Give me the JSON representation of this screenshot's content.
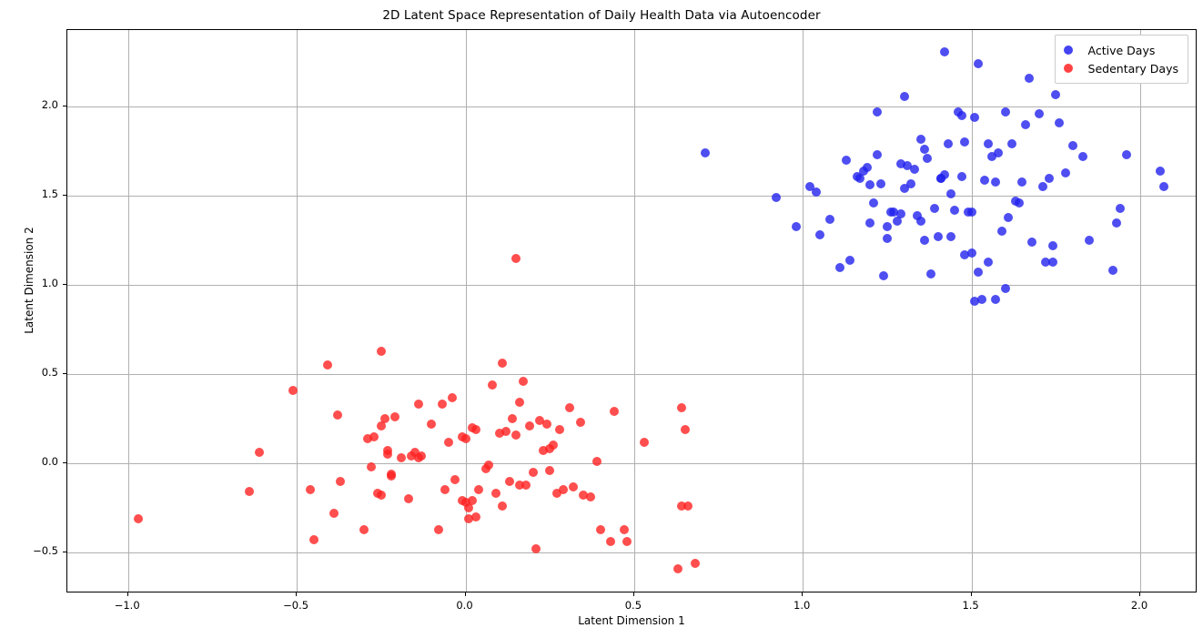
{
  "chart_data": {
    "type": "scatter",
    "title": "2D Latent Space Representation of Daily Health Data via Autoencoder",
    "xlabel": "Latent Dimension 1",
    "ylabel": "Latent Dimension 2",
    "xlim": [
      -1.18,
      2.17
    ],
    "ylim": [
      -0.73,
      2.43
    ],
    "xticks": [
      -1.0,
      -0.5,
      0.0,
      0.5,
      1.0,
      1.5,
      2.0
    ],
    "xticklabels": [
      "−1.0",
      "−0.5",
      "0.0",
      "0.5",
      "1.0",
      "1.5",
      "2.0"
    ],
    "yticks": [
      -0.5,
      0.0,
      0.5,
      1.0,
      1.5,
      2.0
    ],
    "yticklabels": [
      "−0.5",
      "0.0",
      "0.5",
      "1.0",
      "1.5",
      "2.0"
    ],
    "grid": true,
    "legend_position": "upper right",
    "marker_size": 10,
    "marker_alpha": 0.8,
    "series": [
      {
        "name": "Active Days",
        "color": "#2222ee",
        "points": [
          [
            0.71,
            1.74
          ],
          [
            0.92,
            1.49
          ],
          [
            0.98,
            1.33
          ],
          [
            1.02,
            1.55
          ],
          [
            1.04,
            1.52
          ],
          [
            1.05,
            1.28
          ],
          [
            1.08,
            1.37
          ],
          [
            1.11,
            1.1
          ],
          [
            1.13,
            1.7
          ],
          [
            1.14,
            1.14
          ],
          [
            1.16,
            1.61
          ],
          [
            1.17,
            1.6
          ],
          [
            1.18,
            1.64
          ],
          [
            1.19,
            1.66
          ],
          [
            1.2,
            1.35
          ],
          [
            1.2,
            1.56
          ],
          [
            1.21,
            1.46
          ],
          [
            1.22,
            1.97
          ],
          [
            1.22,
            1.73
          ],
          [
            1.23,
            1.57
          ],
          [
            1.24,
            1.05
          ],
          [
            1.25,
            1.26
          ],
          [
            1.25,
            1.33
          ],
          [
            1.26,
            1.41
          ],
          [
            1.27,
            1.41
          ],
          [
            1.28,
            1.36
          ],
          [
            1.29,
            1.68
          ],
          [
            1.29,
            1.4
          ],
          [
            1.3,
            2.06
          ],
          [
            1.3,
            1.54
          ],
          [
            1.31,
            1.67
          ],
          [
            1.32,
            1.57
          ],
          [
            1.33,
            1.65
          ],
          [
            1.34,
            1.39
          ],
          [
            1.35,
            1.82
          ],
          [
            1.35,
            1.36
          ],
          [
            1.36,
            1.76
          ],
          [
            1.36,
            1.25
          ],
          [
            1.37,
            1.71
          ],
          [
            1.38,
            1.06
          ],
          [
            1.39,
            1.43
          ],
          [
            1.4,
            1.27
          ],
          [
            1.41,
            1.6
          ],
          [
            1.41,
            1.6
          ],
          [
            1.42,
            2.31
          ],
          [
            1.42,
            1.62
          ],
          [
            1.43,
            1.79
          ],
          [
            1.44,
            1.51
          ],
          [
            1.44,
            1.27
          ],
          [
            1.45,
            1.42
          ],
          [
            1.46,
            1.97
          ],
          [
            1.47,
            1.95
          ],
          [
            1.47,
            1.61
          ],
          [
            1.48,
            1.8
          ],
          [
            1.48,
            1.17
          ],
          [
            1.49,
            1.41
          ],
          [
            1.5,
            1.18
          ],
          [
            1.5,
            1.41
          ],
          [
            1.51,
            0.91
          ],
          [
            1.51,
            1.94
          ],
          [
            1.52,
            1.07
          ],
          [
            1.52,
            2.24
          ],
          [
            1.53,
            0.92
          ],
          [
            1.54,
            1.59
          ],
          [
            1.55,
            1.79
          ],
          [
            1.55,
            1.13
          ],
          [
            1.56,
            1.72
          ],
          [
            1.57,
            1.58
          ],
          [
            1.57,
            0.92
          ],
          [
            1.58,
            1.74
          ],
          [
            1.59,
            1.3
          ],
          [
            1.6,
            1.97
          ],
          [
            1.6,
            0.98
          ],
          [
            1.61,
            1.38
          ],
          [
            1.62,
            1.79
          ],
          [
            1.63,
            1.47
          ],
          [
            1.64,
            1.46
          ],
          [
            1.65,
            1.58
          ],
          [
            1.66,
            1.9
          ],
          [
            1.67,
            2.16
          ],
          [
            1.68,
            1.24
          ],
          [
            1.7,
            1.96
          ],
          [
            1.71,
            1.55
          ],
          [
            1.72,
            1.13
          ],
          [
            1.73,
            1.6
          ],
          [
            1.74,
            1.13
          ],
          [
            1.74,
            1.22
          ],
          [
            1.75,
            2.07
          ],
          [
            1.76,
            1.91
          ],
          [
            1.78,
            1.63
          ],
          [
            1.8,
            1.78
          ],
          [
            1.83,
            1.72
          ],
          [
            1.85,
            1.25
          ],
          [
            1.92,
            1.08
          ],
          [
            1.94,
            1.43
          ],
          [
            1.96,
            1.73
          ],
          [
            1.93,
            1.35
          ],
          [
            2.06,
            1.64
          ],
          [
            2.07,
            1.55
          ]
        ]
      },
      {
        "name": "Sedentary Days",
        "color": "#ff2222",
        "points": [
          [
            -0.97,
            -0.31
          ],
          [
            -0.64,
            -0.16
          ],
          [
            -0.61,
            0.06
          ],
          [
            -0.51,
            0.41
          ],
          [
            -0.46,
            -0.15
          ],
          [
            -0.45,
            -0.43
          ],
          [
            -0.41,
            0.55
          ],
          [
            -0.39,
            -0.28
          ],
          [
            -0.38,
            0.27
          ],
          [
            -0.37,
            -0.1
          ],
          [
            -0.3,
            -0.37
          ],
          [
            -0.29,
            0.14
          ],
          [
            -0.28,
            -0.02
          ],
          [
            -0.27,
            0.15
          ],
          [
            -0.26,
            -0.17
          ],
          [
            -0.25,
            -0.18
          ],
          [
            -0.25,
            0.21
          ],
          [
            -0.25,
            0.63
          ],
          [
            -0.24,
            0.25
          ],
          [
            -0.23,
            0.05
          ],
          [
            -0.23,
            0.07
          ],
          [
            -0.22,
            -0.07
          ],
          [
            -0.22,
            -0.06
          ],
          [
            -0.21,
            0.26
          ],
          [
            -0.19,
            0.03
          ],
          [
            -0.17,
            -0.2
          ],
          [
            -0.16,
            0.04
          ],
          [
            -0.15,
            0.06
          ],
          [
            -0.14,
            0.03
          ],
          [
            -0.14,
            0.33
          ],
          [
            -0.13,
            0.04
          ],
          [
            -0.1,
            0.22
          ],
          [
            -0.08,
            -0.37
          ],
          [
            -0.07,
            0.33
          ],
          [
            -0.06,
            -0.15
          ],
          [
            -0.05,
            0.12
          ],
          [
            -0.04,
            0.37
          ],
          [
            -0.03,
            -0.09
          ],
          [
            -0.01,
            0.15
          ],
          [
            -0.01,
            -0.21
          ],
          [
            0.0,
            0.14
          ],
          [
            0.0,
            -0.22
          ],
          [
            0.01,
            -0.31
          ],
          [
            0.01,
            -0.25
          ],
          [
            0.02,
            0.2
          ],
          [
            0.02,
            -0.21
          ],
          [
            0.03,
            0.19
          ],
          [
            0.03,
            -0.3
          ],
          [
            0.04,
            -0.15
          ],
          [
            0.06,
            -0.03
          ],
          [
            0.07,
            -0.01
          ],
          [
            0.08,
            0.44
          ],
          [
            0.09,
            -0.17
          ],
          [
            0.1,
            0.17
          ],
          [
            0.11,
            -0.24
          ],
          [
            0.11,
            0.56
          ],
          [
            0.12,
            0.18
          ],
          [
            0.13,
            -0.1
          ],
          [
            0.14,
            0.25
          ],
          [
            0.15,
            1.15
          ],
          [
            0.15,
            0.16
          ],
          [
            0.16,
            -0.12
          ],
          [
            0.16,
            0.34
          ],
          [
            0.17,
            0.46
          ],
          [
            0.18,
            -0.12
          ],
          [
            0.19,
            0.21
          ],
          [
            0.2,
            -0.05
          ],
          [
            0.21,
            -0.48
          ],
          [
            0.22,
            0.24
          ],
          [
            0.23,
            0.07
          ],
          [
            0.24,
            0.22
          ],
          [
            0.25,
            0.08
          ],
          [
            0.25,
            -0.04
          ],
          [
            0.26,
            0.1
          ],
          [
            0.27,
            -0.17
          ],
          [
            0.28,
            0.19
          ],
          [
            0.29,
            -0.15
          ],
          [
            0.31,
            0.31
          ],
          [
            0.32,
            -0.13
          ],
          [
            0.34,
            0.23
          ],
          [
            0.35,
            -0.18
          ],
          [
            0.37,
            -0.19
          ],
          [
            0.39,
            0.01
          ],
          [
            0.4,
            -0.37
          ],
          [
            0.43,
            -0.44
          ],
          [
            0.44,
            0.29
          ],
          [
            0.47,
            -0.37
          ],
          [
            0.48,
            -0.44
          ],
          [
            0.53,
            0.12
          ],
          [
            0.63,
            -0.59
          ],
          [
            0.64,
            0.31
          ],
          [
            0.64,
            -0.24
          ],
          [
            0.65,
            0.19
          ],
          [
            0.66,
            -0.24
          ],
          [
            0.68,
            -0.56
          ]
        ]
      }
    ]
  }
}
